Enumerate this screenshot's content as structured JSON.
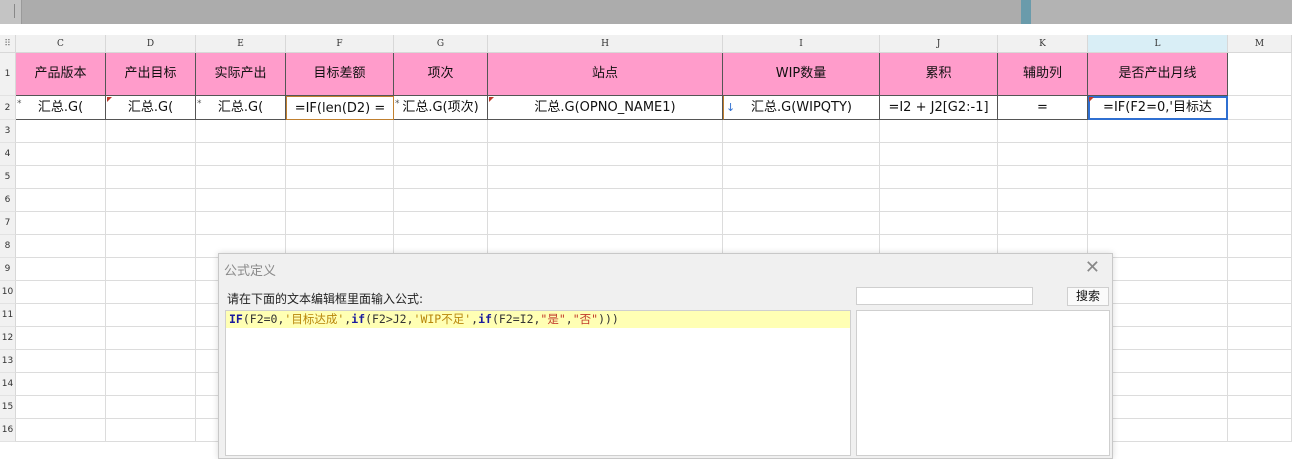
{
  "columns": [
    "C",
    "D",
    "E",
    "F",
    "G",
    "H",
    "I",
    "J",
    "K",
    "L",
    "M"
  ],
  "rows": [
    "1",
    "2",
    "3",
    "4",
    "5",
    "6",
    "7",
    "8",
    "9",
    "10",
    "11",
    "12",
    "13",
    "14",
    "15",
    "16"
  ],
  "selected_column": "L",
  "header_row": [
    "产品版本",
    "产出目标",
    "实际产出",
    "目标差额",
    "项次",
    "站点",
    "WIP数量",
    "累积",
    "辅助列",
    "是否产出月线"
  ],
  "data_row": [
    "汇总.G(",
    "汇总.G(",
    "汇总.G(",
    "=IF(len(D2) =",
    "汇总.G(项次)",
    "汇总.G(OPNO_NAME1)",
    "汇总.G(WIPQTY)",
    "=I2 + J2[G2:-1]",
    "=",
    "=IF(F2=0,'目标达"
  ],
  "colors": {
    "header_fill": "#ff9ccb",
    "selection": "#2f6fd1",
    "formula_highlight": "#ffffb4"
  },
  "dialog": {
    "title": "公式定义",
    "prompt": "请在下面的文本编辑框里面输入公式:",
    "search_placeholder": "",
    "search_button": "搜索",
    "formula_tokens": [
      "IF",
      "(F2=0,",
      "'目标达成'",
      ",",
      "if",
      "(F2>J2,",
      "'WIP不足'",
      ",",
      "if",
      "(F2=I2,",
      "\"是\"",
      ",",
      "\"否\"",
      ")))"
    ]
  }
}
